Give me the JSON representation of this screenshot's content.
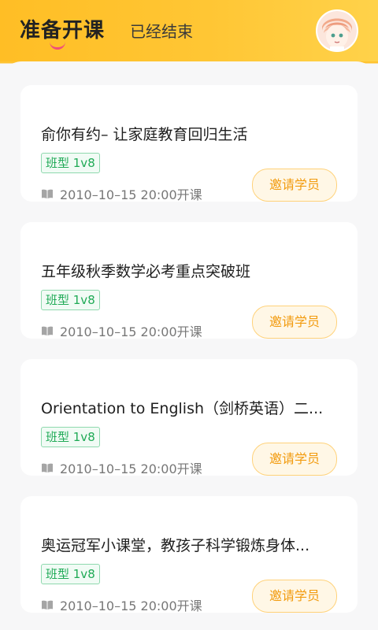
{
  "tabs": [
    {
      "label": "准备开课",
      "active": true
    },
    {
      "label": "已经结束",
      "active": false
    }
  ],
  "courses": [
    {
      "title": "俞你有约– 让家庭教育回归生活",
      "badge": "班型 1v8",
      "time": "2010–10–15 20:00开课",
      "action": "邀请学员"
    },
    {
      "title": "五年级秋季数学必考重点突破班",
      "badge": "班型 1v8",
      "time": "2010–10–15 20:00开课",
      "action": "邀请学员"
    },
    {
      "title": "Orientation to English（剑桥英语）二...",
      "badge": "班型 1v8",
      "time": "2010–10–15 20:00开课",
      "action": "邀请学员"
    },
    {
      "title": "奥运冠军小课堂，教孩子科学锻炼身体...",
      "badge": "班型 1v8",
      "time": "2010–10–15 20:00开课",
      "action": "邀请学员"
    }
  ],
  "colors": {
    "accent": "#FFC330",
    "badge_green": "#1FAA56",
    "invite_orange": "#F29B0E",
    "tab_indicator": "#F04E7A"
  },
  "icons": {
    "book": "book-icon",
    "avatar": "avatar"
  }
}
